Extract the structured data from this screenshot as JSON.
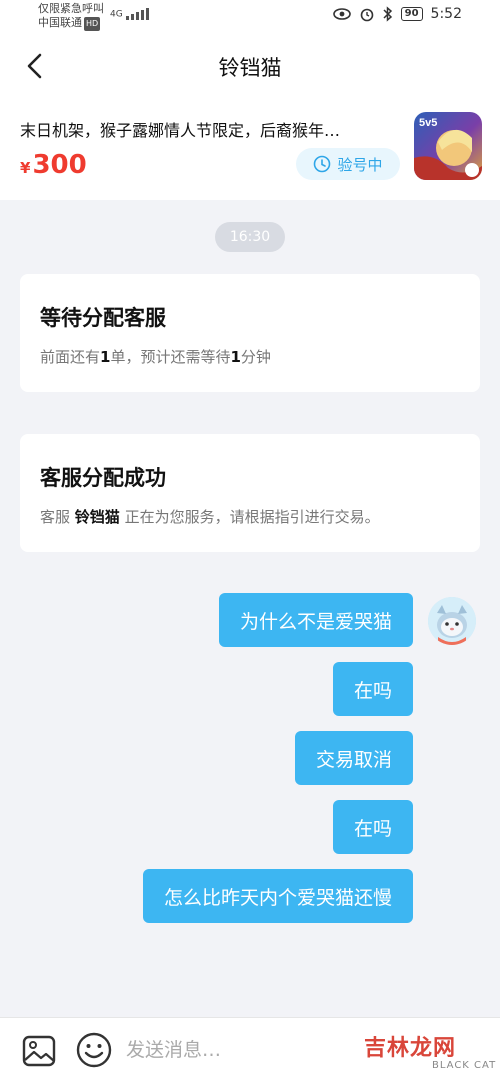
{
  "status_bar": {
    "line1": "仅限紧急呼叫",
    "carrier": "中国联通",
    "hd": "HD",
    "network": "4G",
    "battery": "90",
    "time": "5:52"
  },
  "header": {
    "title": "铃铛猫"
  },
  "product": {
    "title": "末日机架，猴子露娜情人节限定，后裔猴年…",
    "currency": "¥",
    "price": "300",
    "status": "验号中",
    "game_icon_label": "5v5"
  },
  "chat": {
    "timestamp": "16:30",
    "card1": {
      "title": "等待分配客服",
      "desc_pre": "前面还有",
      "queue": "1",
      "desc_mid": "单，预计还需等待",
      "wait": "1",
      "desc_post": "分钟"
    },
    "card2": {
      "title": "客服分配成功",
      "desc_pre": "客服 ",
      "agent": "铃铛猫",
      "desc_post": " 正在为您服务，请根据指引进行交易。"
    },
    "messages": [
      "为什么不是爱哭猫",
      "在吗",
      "交易取消",
      "在吗",
      "怎么比昨天内个爱哭猫还慢"
    ]
  },
  "input": {
    "placeholder": "发送消息…"
  },
  "watermark": {
    "text": "吉林龙网",
    "sub": "BLACK CAT"
  },
  "colors": {
    "bubble": "#3db6f2",
    "price": "#ef3b2f",
    "status_pill_text": "#2ea6e8"
  }
}
